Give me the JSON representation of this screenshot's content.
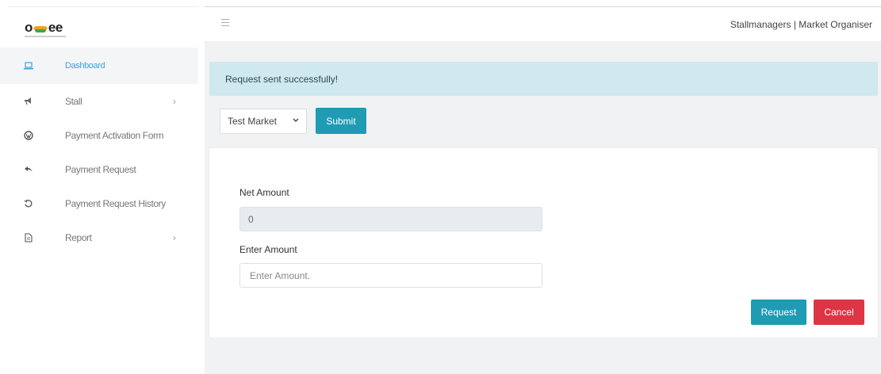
{
  "logo": {
    "text_left": "o",
    "text_right": "ee"
  },
  "sidebar": {
    "items": [
      {
        "label": "Dashboard",
        "icon": "laptop-icon",
        "active": true
      },
      {
        "label": "Stall",
        "icon": "megaphone-icon",
        "chevron": "›"
      },
      {
        "label": "Payment Activation Form",
        "icon": "wordpress-icon"
      },
      {
        "label": "Payment Request",
        "icon": "reply-icon"
      },
      {
        "label": "Payment Request History",
        "icon": "history-icon"
      },
      {
        "label": "Report",
        "icon": "file-icon",
        "chevron": "›"
      }
    ]
  },
  "header": {
    "user_text": "Stallmanagers | Market Organiser"
  },
  "alert": {
    "message": "Request sent successfully!"
  },
  "market": {
    "selected": "Test Market",
    "submit_label": "Submit"
  },
  "form": {
    "net_amount_label": "Net Amount",
    "net_amount_value": "0",
    "enter_amount_label": "Enter Amount",
    "enter_amount_placeholder": "Enter Amount.",
    "request_label": "Request",
    "cancel_label": "Cancel"
  },
  "colors": {
    "primary": "#1f9bb4",
    "danger": "#dc3545",
    "alert_bg": "#cfe9ee",
    "active_link": "#3aa6dc"
  }
}
